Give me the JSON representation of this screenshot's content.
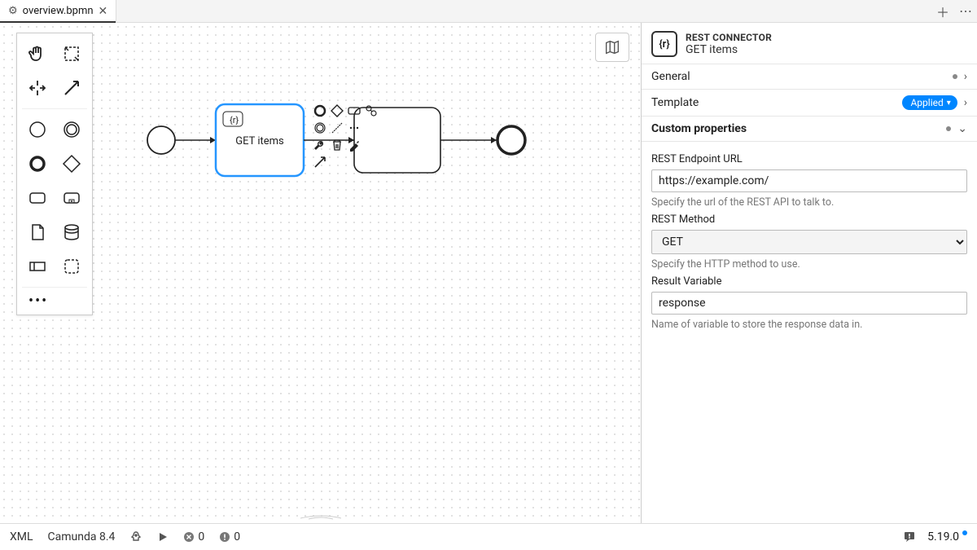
{
  "tab": {
    "name": "overview.bpmn"
  },
  "panel": {
    "kind": "REST CONNECTOR",
    "name": "GET items",
    "icon_label": "{r}",
    "general": "General",
    "template": "Template",
    "template_badge": "Applied",
    "custom": "Custom properties",
    "url_label": "REST Endpoint URL",
    "url_value": "https://example.com/",
    "url_help": "Specify the url of the REST API to talk to.",
    "method_label": "REST Method",
    "method_value": "GET",
    "method_help": "Specify the HTTP method to use.",
    "result_label": "Result Variable",
    "result_value": "response",
    "result_help": "Name of variable to store the response data in."
  },
  "diagram": {
    "task1_label": "GET items",
    "task1_icon": "{r}"
  },
  "status": {
    "xml": "XML",
    "engine": "Camunda 8.4",
    "err_x": "0",
    "err_warn": "0",
    "version": "5.19.0"
  }
}
